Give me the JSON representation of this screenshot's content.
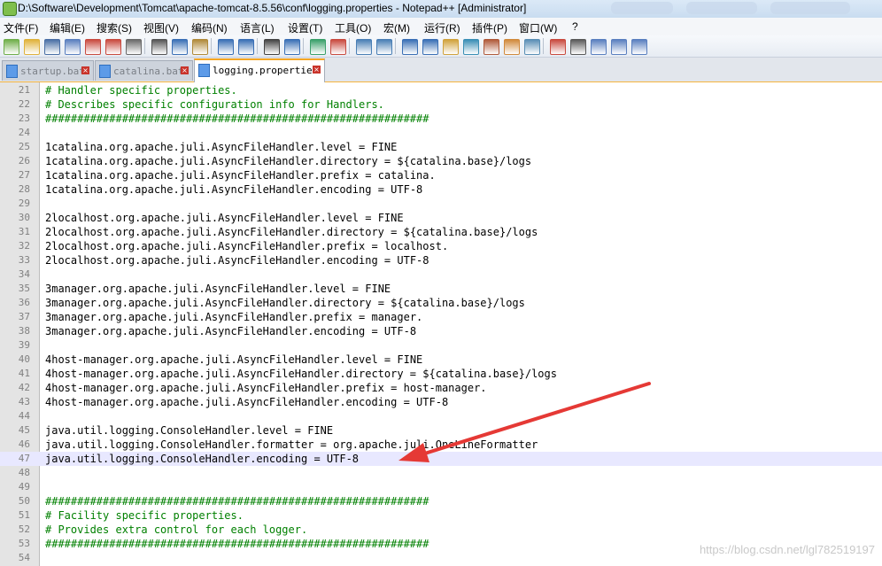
{
  "window": {
    "title": "D:\\Software\\Development\\Tomcat\\apache-tomcat-8.5.56\\conf\\logging.properties - Notepad++ [Administrator]"
  },
  "menu": [
    "文件(F)",
    "编辑(E)",
    "搜索(S)",
    "视图(V)",
    "编码(N)",
    "语言(L)",
    "设置(T)",
    "工具(O)",
    "宏(M)",
    "运行(R)",
    "插件(P)",
    "窗口(W)",
    "?"
  ],
  "tabs": [
    {
      "label": "startup.bat",
      "active": false
    },
    {
      "label": "catalina.bat",
      "active": false
    },
    {
      "label": "logging.properties",
      "active": true
    }
  ],
  "toolbar_icons": [
    "new-file-icon",
    "open-file-icon",
    "save-icon",
    "save-all-icon",
    "close-icon",
    "close-all-icon",
    "print-icon",
    "cut-icon",
    "copy-icon",
    "paste-icon",
    "undo-icon",
    "redo-icon",
    "find-icon",
    "replace-icon",
    "zoom-in-icon",
    "zoom-out-icon",
    "sync-v-icon",
    "sync-h-icon",
    "word-wrap-icon",
    "show-all-chars-icon",
    "indent-guide-icon",
    "doc-map-icon",
    "function-list-icon",
    "folder-workspace-icon",
    "monitor-icon",
    "record-macro-icon",
    "stop-macro-icon",
    "play-macro-icon",
    "run-macro-multiple-icon",
    "save-macro-icon"
  ],
  "lines": [
    {
      "n": "21",
      "type": "comment",
      "text": "# Handler specific properties."
    },
    {
      "n": "22",
      "type": "comment",
      "text": "# Describes specific configuration info for Handlers."
    },
    {
      "n": "23",
      "type": "comment",
      "text": "############################################################"
    },
    {
      "n": "24",
      "type": "blank",
      "text": ""
    },
    {
      "n": "25",
      "type": "prop",
      "key": "1catalina.org.apache.juli.AsyncFileHandler.level",
      "value": "FINE"
    },
    {
      "n": "26",
      "type": "prop",
      "key": "1catalina.org.apache.juli.AsyncFileHandler.directory",
      "value": "${catalina.base}/logs"
    },
    {
      "n": "27",
      "type": "prop",
      "key": "1catalina.org.apache.juli.AsyncFileHandler.prefix",
      "value": "catalina."
    },
    {
      "n": "28",
      "type": "prop",
      "key": "1catalina.org.apache.juli.AsyncFileHandler.encoding",
      "value": "UTF-8"
    },
    {
      "n": "29",
      "type": "blank",
      "text": ""
    },
    {
      "n": "30",
      "type": "prop",
      "key": "2localhost.org.apache.juli.AsyncFileHandler.level",
      "value": "FINE"
    },
    {
      "n": "31",
      "type": "prop",
      "key": "2localhost.org.apache.juli.AsyncFileHandler.directory",
      "value": "${catalina.base}/logs"
    },
    {
      "n": "32",
      "type": "prop",
      "key": "2localhost.org.apache.juli.AsyncFileHandler.prefix",
      "value": "localhost."
    },
    {
      "n": "33",
      "type": "prop",
      "key": "2localhost.org.apache.juli.AsyncFileHandler.encoding",
      "value": "UTF-8"
    },
    {
      "n": "34",
      "type": "blank",
      "text": ""
    },
    {
      "n": "35",
      "type": "prop",
      "key": "3manager.org.apache.juli.AsyncFileHandler.level",
      "value": "FINE"
    },
    {
      "n": "36",
      "type": "prop",
      "key": "3manager.org.apache.juli.AsyncFileHandler.directory",
      "value": "${catalina.base}/logs"
    },
    {
      "n": "37",
      "type": "prop",
      "key": "3manager.org.apache.juli.AsyncFileHandler.prefix",
      "value": "manager."
    },
    {
      "n": "38",
      "type": "prop",
      "key": "3manager.org.apache.juli.AsyncFileHandler.encoding",
      "value": "UTF-8"
    },
    {
      "n": "39",
      "type": "blank",
      "text": ""
    },
    {
      "n": "40",
      "type": "prop",
      "key": "4host-manager.org.apache.juli.AsyncFileHandler.level",
      "value": "FINE"
    },
    {
      "n": "41",
      "type": "prop",
      "key": "4host-manager.org.apache.juli.AsyncFileHandler.directory",
      "value": "${catalina.base}/logs"
    },
    {
      "n": "42",
      "type": "prop",
      "key": "4host-manager.org.apache.juli.AsyncFileHandler.prefix",
      "value": "host-manager."
    },
    {
      "n": "43",
      "type": "prop",
      "key": "4host-manager.org.apache.juli.AsyncFileHandler.encoding",
      "value": "UTF-8"
    },
    {
      "n": "44",
      "type": "blank",
      "text": ""
    },
    {
      "n": "45",
      "type": "prop",
      "key": "java.util.logging.ConsoleHandler.level",
      "value": "FINE"
    },
    {
      "n": "46",
      "type": "prop",
      "key": "java.util.logging.ConsoleHandler.formatter",
      "value": "org.apache.juli.OneLineFormatter"
    },
    {
      "n": "47",
      "type": "prop",
      "key": "java.util.logging.ConsoleHandler.encoding",
      "value": "UTF-8",
      "current": true
    },
    {
      "n": "48",
      "type": "blank",
      "text": ""
    },
    {
      "n": "49",
      "type": "blank",
      "text": ""
    },
    {
      "n": "50",
      "type": "comment",
      "text": "############################################################"
    },
    {
      "n": "51",
      "type": "comment",
      "text": "# Facility specific properties."
    },
    {
      "n": "52",
      "type": "comment",
      "text": "# Provides extra control for each logger."
    },
    {
      "n": "53",
      "type": "comment",
      "text": "############################################################"
    },
    {
      "n": "54",
      "type": "blank",
      "text": ""
    }
  ],
  "annotation": {
    "color": "#e53935"
  },
  "watermark": "https://blog.csdn.net/lgl782519197",
  "colors": {
    "comment": "#008000",
    "current_line": "#e8e8ff",
    "tab_accent": "#f5a623"
  }
}
